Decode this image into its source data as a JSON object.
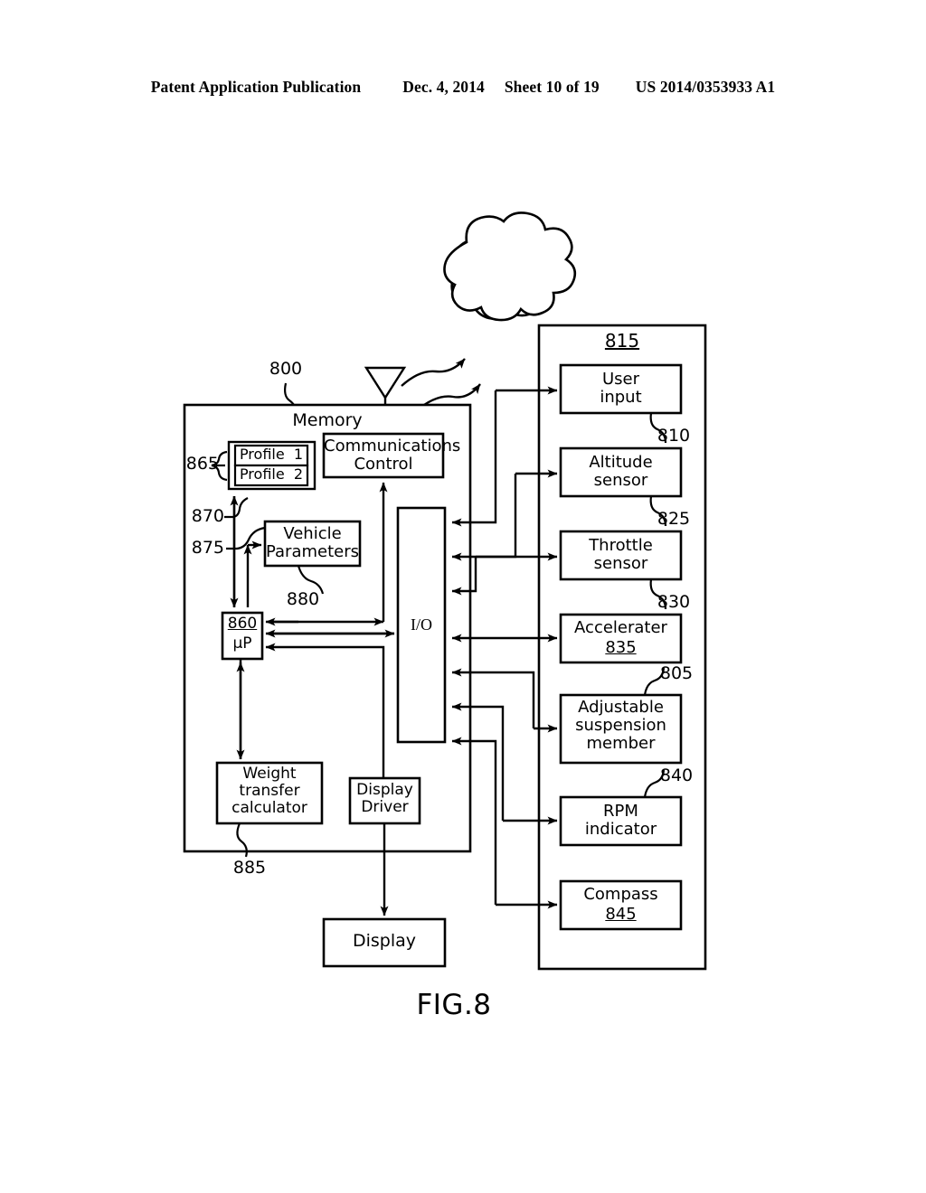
{
  "header": {
    "publication": "Patent Application Publication",
    "date": "Dec. 4, 2014",
    "sheet": "Sheet 10 of 19",
    "docnum": "US 2014/0353933 A1"
  },
  "figure": {
    "caption": "FIG.8",
    "system_ref": "800",
    "memory_label": "Memory",
    "cloud": "cloud-icon",
    "antenna": "antenna-icon"
  },
  "memory_block": {
    "profiles": {
      "ref": "865",
      "items": [
        "Profile  1",
        "Profile  2"
      ]
    },
    "profile_bus_ref": "870",
    "vehicle_params_bus_ref": "875",
    "vehicle_parameters": {
      "label": "Vehicle\nParameters",
      "ref": "880"
    },
    "communications_control": {
      "label": "Communications\nControl"
    },
    "microprocessor": {
      "ref": "860",
      "label": "µP"
    },
    "io": {
      "label": "I/O"
    },
    "weight_transfer_calculator": {
      "label": "Weight\ntransfer\ncalculator",
      "ref": "885"
    },
    "display_driver": {
      "label": "Display\nDriver"
    }
  },
  "display": {
    "label": "Display"
  },
  "peripherals": {
    "container_ref": "815",
    "items": [
      {
        "label": "User\ninput",
        "ref": "810",
        "ref_underlined": false
      },
      {
        "label": "Altitude\nsensor",
        "ref": "825",
        "ref_underlined": false
      },
      {
        "label": "Throttle\nsensor",
        "ref": "830",
        "ref_underlined": false
      },
      {
        "label": "Accelerater",
        "ref": "835",
        "ref_underlined": true
      },
      {
        "label": "Adjustable\nsuspension\nmember",
        "ref": "805",
        "ref_underlined": false
      },
      {
        "label": "RPM\nindicator",
        "ref": "840",
        "ref_underlined": false
      },
      {
        "label": "Compass",
        "ref": "845",
        "ref_underlined": true
      }
    ]
  },
  "colors": {
    "ink": "#000000",
    "paper": "#ffffff"
  }
}
